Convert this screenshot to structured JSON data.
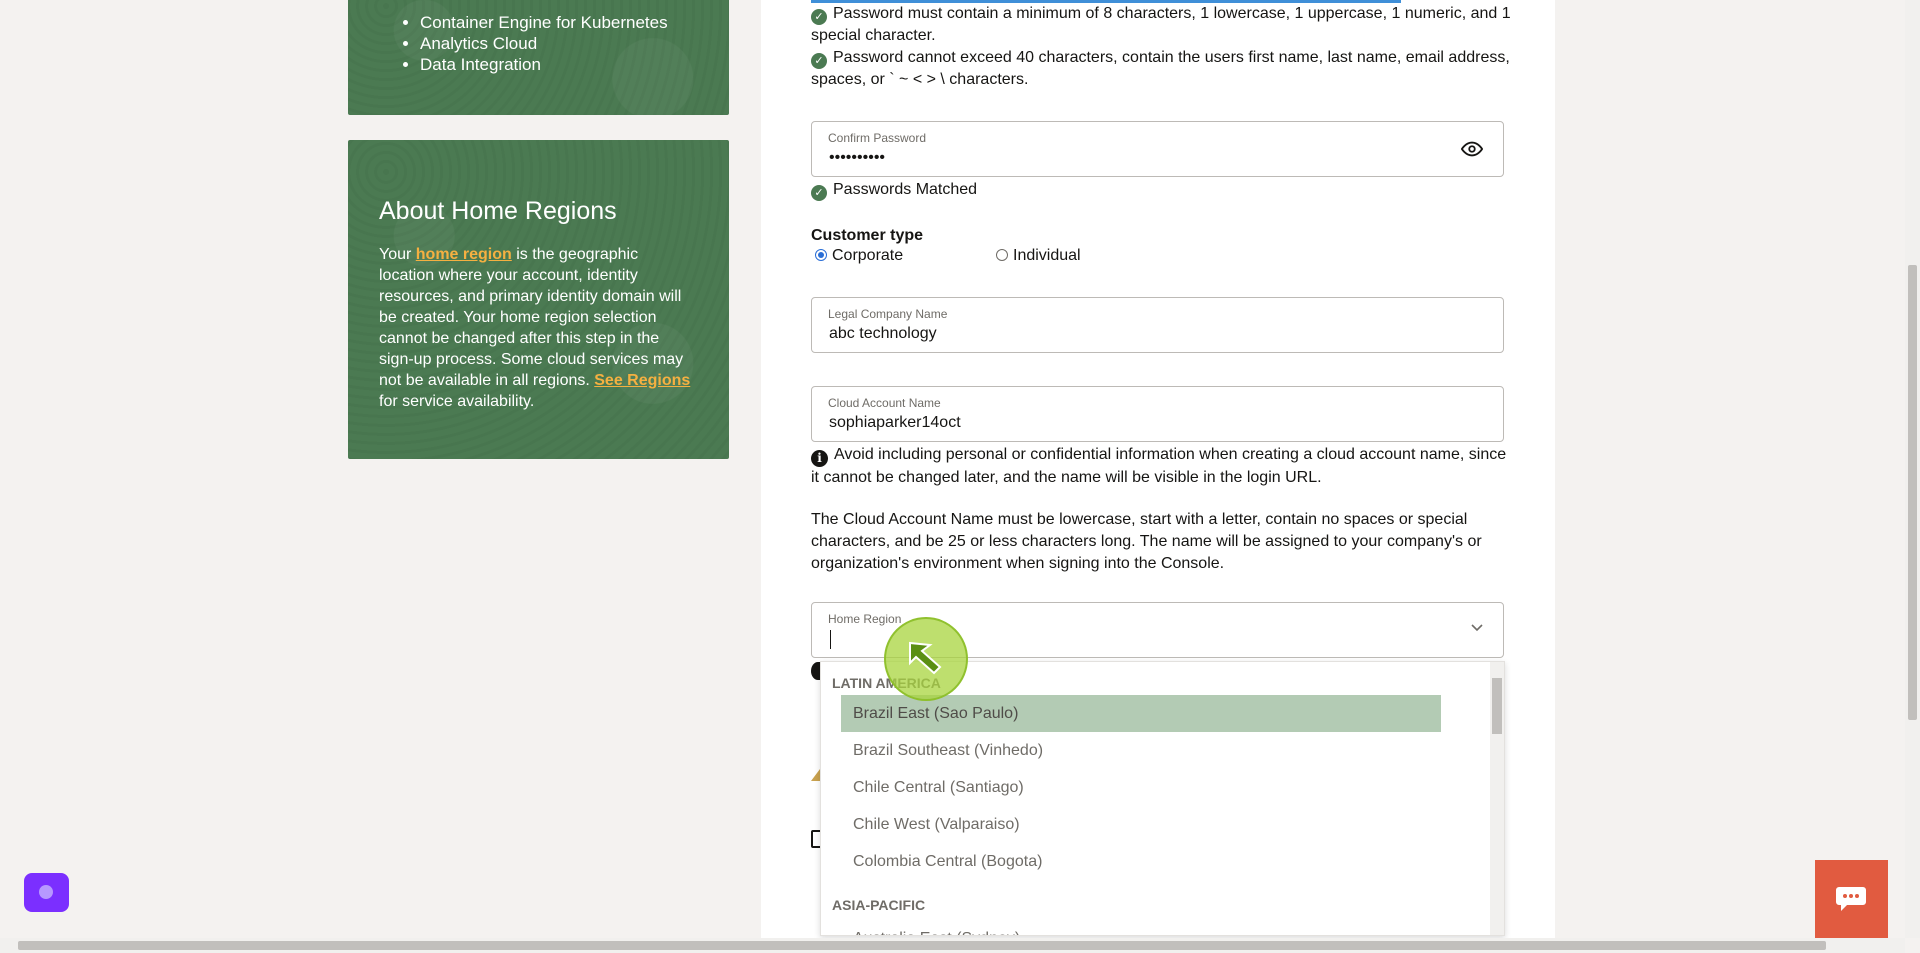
{
  "sidebar": {
    "services": [
      "Container Engine for Kubernetes",
      "Analytics Cloud",
      "Data Integration"
    ],
    "about": {
      "title": "About Home Regions",
      "text_1": "Your ",
      "link_home_region": "home region",
      "text_2": " is the geographic location where your account, identity resources, and primary identity domain will be created. Your home region selection cannot be changed after this step in the sign-up process. Some cloud services may not be available in all regions. ",
      "link_see_regions": "See Regions",
      "text_3": " for service availability."
    }
  },
  "form": {
    "password_rules": [
      "Password must contain a minimum of 8 characters, 1 lowercase, 1 uppercase, 1 numeric, and 1 special character.",
      "Password cannot exceed 40 characters, contain the users first name, last name, email address, spaces, or ` ~ < > \\ characters."
    ],
    "confirm_password": {
      "label": "Confirm Password",
      "value": "••••••••••"
    },
    "passwords_matched": "Passwords Matched",
    "customer_type": {
      "label": "Customer type",
      "options": [
        "Corporate",
        "Individual"
      ],
      "selected": "Corporate"
    },
    "legal_company_name": {
      "label": "Legal Company Name",
      "value": "abc technology"
    },
    "cloud_account_name": {
      "label": "Cloud Account Name",
      "value": "sophiaparker14oct"
    },
    "info_note": "Avoid including personal or confidential information when creating a cloud account name, since it cannot be changed later, and the name will be visible in the login URL.",
    "account_rules": "The Cloud Account Name must be lowercase, start with a letter, contain no spaces or special characters, and be 25 or less characters long. The name will be assigned to your company's or organization's environment when signing into the Console.",
    "home_region": {
      "label": "Home Region",
      "value": ""
    }
  },
  "dropdown": {
    "group_latin": "LATIN AMERICA",
    "latin_options": [
      "Brazil East (Sao Paulo)",
      "Brazil Southeast (Vinhedo)",
      "Chile Central (Santiago)",
      "Chile West (Valparaiso)",
      "Colombia Central (Bogota)"
    ],
    "highlighted": "Brazil East (Sao Paulo)",
    "group_asia": "ASIA-PACIFIC",
    "asia_options": [
      "Australia East (Sydney)"
    ]
  },
  "colors": {
    "sidebar_green": "#4b7a52",
    "link_orange": "#f5b041",
    "option_highlight": "#b3cbb4",
    "chat_button": "#e15b40"
  }
}
